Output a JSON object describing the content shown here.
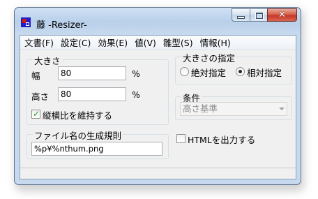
{
  "window": {
    "title": "藤 -Resizer-",
    "close_glyph": "✕",
    "colors": {
      "titlebar": "#b9d0ea",
      "close": "#c5372a",
      "client": "#f0f0f0"
    }
  },
  "menu": [
    "文書(F)",
    "設定(C)",
    "効果(E)",
    "値(V)",
    "雛型(S)",
    "情報(H)"
  ],
  "size_group": {
    "label": "大きさ",
    "width_label": "幅",
    "width_value": "80",
    "width_unit": "%",
    "height_label": "高さ",
    "height_value": "80",
    "height_unit": "%",
    "keep_ratio_label": "縦横比を維持する",
    "keep_ratio_checked": true
  },
  "size_spec_group": {
    "label": "大きさの指定",
    "absolute_label": "絶対指定",
    "relative_label": "相対指定",
    "selected": "relative"
  },
  "condition_group": {
    "label": "条件",
    "selected_value": "高さ基準"
  },
  "filename_group": {
    "label": "ファイル名の生成規則",
    "value": "%p¥%nthum.png"
  },
  "html_output": {
    "label": "HTMLを出力する",
    "checked": false
  },
  "statusbar": {
    "text": ""
  }
}
